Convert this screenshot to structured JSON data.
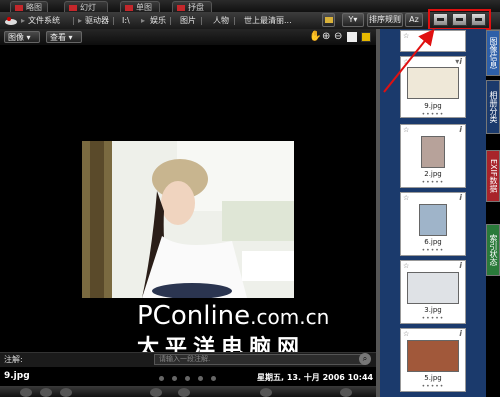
{
  "mode_tabs": [
    "略图",
    "幻灯片",
    "单图",
    "抒盘"
  ],
  "breadcrumb": [
    "文件系统",
    "驱动器",
    "I:\\",
    "娱乐",
    "图片",
    "人物",
    "世上最清丽..."
  ],
  "toolbar": {
    "sort_label": "排序规则",
    "az_label": "Az"
  },
  "row2": {
    "dropdown1": "图像",
    "dropdown2": "查看"
  },
  "watermark": {
    "line1_big": "PConline",
    "line1_small": ".com.cn",
    "line2": "太平洋电脑网"
  },
  "note": {
    "label": "注解:",
    "placeholder": "请输入一段注解."
  },
  "status": {
    "filename": "9.jpg",
    "datetime": "星期五, 13. 十月 2006 10:44"
  },
  "thumbnails": [
    {
      "label": "9.jpg"
    },
    {
      "label": "2.jpg"
    },
    {
      "label": "6.jpg"
    },
    {
      "label": "3.jpg"
    },
    {
      "label": "5.jpg"
    }
  ],
  "side_tabs": [
    "图像信息",
    "相册分类",
    "EXIF数据",
    "索引状态"
  ],
  "colors": {
    "side_blue": "#1b3a6c",
    "highlight_red": "#e01010",
    "tab_green": "#2a7a3a",
    "tab_red": "#a8242a"
  }
}
